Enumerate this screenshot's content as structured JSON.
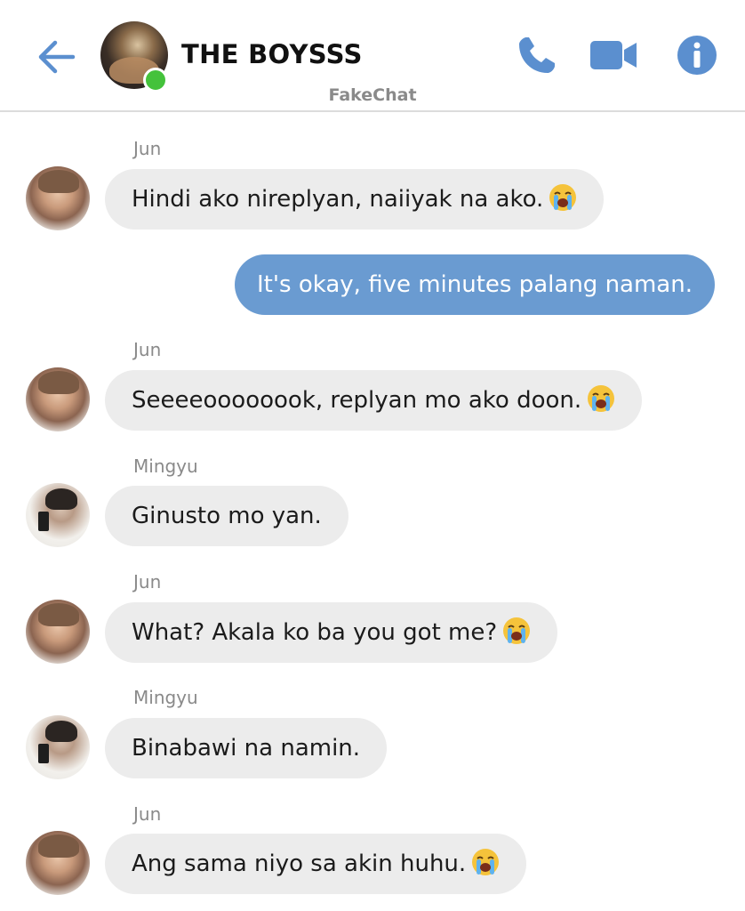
{
  "header": {
    "title": "THE BOYSSS",
    "app_label": "FakeChat",
    "accent_color": "#5b8fcf",
    "online_color": "#44c23b",
    "icons": [
      "back-arrow-icon",
      "phone-icon",
      "video-camera-icon",
      "info-icon"
    ]
  },
  "messages": [
    {
      "sender": "Jun",
      "text": "Hindi ako nireplyan, naiiyak na ako.",
      "emoji": "loudly-crying-face"
    },
    {
      "sender": "me",
      "text": "It's okay, five minutes palang naman."
    },
    {
      "sender": "Jun",
      "text": "Seeeeoooooook, replyan mo ako doon.",
      "emoji": "loudly-crying-face"
    },
    {
      "sender": "Mingyu",
      "text": "Ginusto mo yan."
    },
    {
      "sender": "Jun",
      "text": "What? Akala ko ba you got me?",
      "emoji": "loudly-crying-face"
    },
    {
      "sender": "Mingyu",
      "text": "Binabawi na namin."
    },
    {
      "sender": "Jun",
      "text": "Ang sama niyo sa akin huhu.",
      "emoji": "loudly-crying-face"
    }
  ],
  "colors": {
    "incoming_bubble": "#ececec",
    "outgoing_bubble": "#6a9bd1",
    "sender_name": "#8a8a8a"
  }
}
